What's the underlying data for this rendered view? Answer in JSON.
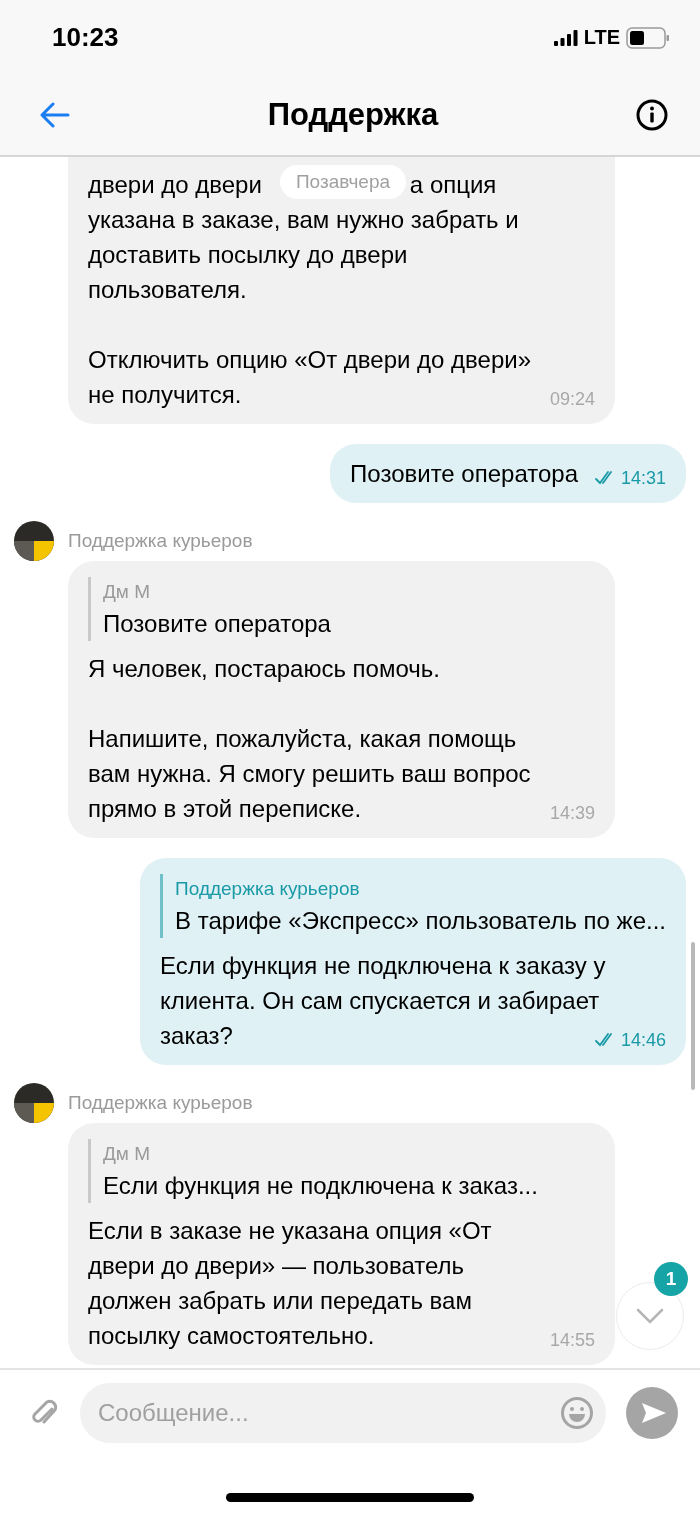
{
  "status_bar": {
    "time": "10:23",
    "network": "LTE"
  },
  "header": {
    "title": "Поддержка"
  },
  "date_chip": "Позавчера",
  "messages": [
    {
      "kind": "incoming",
      "partial_line": {
        "left": "двери до двери",
        "right": "а опция"
      },
      "text": "указана в заказе, вам нужно забрать и\nдоставить посылку до двери\nпользователя.\n\nОтключить опцию «От двери до двери»\nне получится.",
      "time": "09:24"
    },
    {
      "kind": "outgoing",
      "text": "Позовите оператора",
      "time": "14:31",
      "read": true
    },
    {
      "kind": "incoming",
      "sender": "Поддержка курьеров",
      "quote": {
        "author": "Дм М",
        "text": "Позовите оператора"
      },
      "text": "Я человек, постараюсь помочь.\n\nНапишите, пожалуйста, какая помощь\nвам нужна. Я смогу решить ваш вопрос\nпрямо в этой переписке.",
      "time": "14:39"
    },
    {
      "kind": "outgoing",
      "quote": {
        "author": "Поддержка курьеров",
        "text": "В тарифе «Экспресс» пользователь по же..."
      },
      "text": "Если функция не подключена к заказу у\nклиента. Он сам спускается и забирает\nзаказ?",
      "time": "14:46",
      "read": true
    },
    {
      "kind": "incoming",
      "sender": "Поддержка курьеров",
      "quote": {
        "author": "Дм М",
        "text": "Если функция не подключена к заказ..."
      },
      "text": "Если в заказе не указана опция «От\nдвери до двери» — пользователь\nдолжен забрать или передать вам\nпосылку самостоятельно.",
      "time": "14:55"
    }
  ],
  "scroll_down": {
    "badge": "1"
  },
  "composer": {
    "placeholder": "Сообщение..."
  }
}
